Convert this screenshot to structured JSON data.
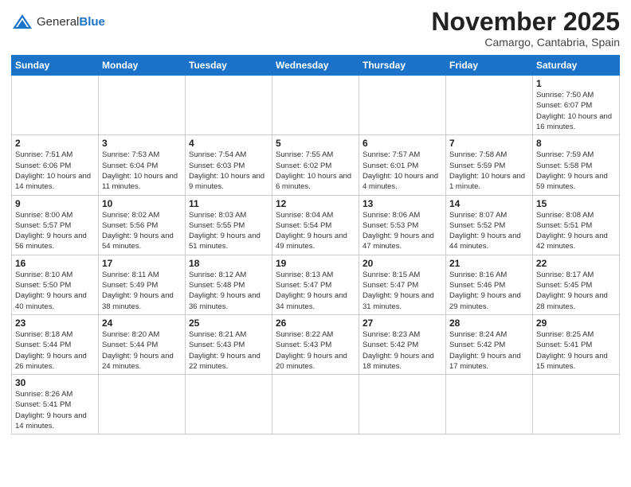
{
  "header": {
    "logo_general": "General",
    "logo_blue": "Blue",
    "month_title": "November 2025",
    "location": "Camargo, Cantabria, Spain"
  },
  "weekdays": [
    "Sunday",
    "Monday",
    "Tuesday",
    "Wednesday",
    "Thursday",
    "Friday",
    "Saturday"
  ],
  "weeks": [
    [
      {
        "day": "",
        "info": ""
      },
      {
        "day": "",
        "info": ""
      },
      {
        "day": "",
        "info": ""
      },
      {
        "day": "",
        "info": ""
      },
      {
        "day": "",
        "info": ""
      },
      {
        "day": "",
        "info": ""
      },
      {
        "day": "1",
        "info": "Sunrise: 7:50 AM\nSunset: 6:07 PM\nDaylight: 10 hours and 16 minutes."
      }
    ],
    [
      {
        "day": "2",
        "info": "Sunrise: 7:51 AM\nSunset: 6:06 PM\nDaylight: 10 hours and 14 minutes."
      },
      {
        "day": "3",
        "info": "Sunrise: 7:53 AM\nSunset: 6:04 PM\nDaylight: 10 hours and 11 minutes."
      },
      {
        "day": "4",
        "info": "Sunrise: 7:54 AM\nSunset: 6:03 PM\nDaylight: 10 hours and 9 minutes."
      },
      {
        "day": "5",
        "info": "Sunrise: 7:55 AM\nSunset: 6:02 PM\nDaylight: 10 hours and 6 minutes."
      },
      {
        "day": "6",
        "info": "Sunrise: 7:57 AM\nSunset: 6:01 PM\nDaylight: 10 hours and 4 minutes."
      },
      {
        "day": "7",
        "info": "Sunrise: 7:58 AM\nSunset: 5:59 PM\nDaylight: 10 hours and 1 minute."
      },
      {
        "day": "8",
        "info": "Sunrise: 7:59 AM\nSunset: 5:58 PM\nDaylight: 9 hours and 59 minutes."
      }
    ],
    [
      {
        "day": "9",
        "info": "Sunrise: 8:00 AM\nSunset: 5:57 PM\nDaylight: 9 hours and 56 minutes."
      },
      {
        "day": "10",
        "info": "Sunrise: 8:02 AM\nSunset: 5:56 PM\nDaylight: 9 hours and 54 minutes."
      },
      {
        "day": "11",
        "info": "Sunrise: 8:03 AM\nSunset: 5:55 PM\nDaylight: 9 hours and 51 minutes."
      },
      {
        "day": "12",
        "info": "Sunrise: 8:04 AM\nSunset: 5:54 PM\nDaylight: 9 hours and 49 minutes."
      },
      {
        "day": "13",
        "info": "Sunrise: 8:06 AM\nSunset: 5:53 PM\nDaylight: 9 hours and 47 minutes."
      },
      {
        "day": "14",
        "info": "Sunrise: 8:07 AM\nSunset: 5:52 PM\nDaylight: 9 hours and 44 minutes."
      },
      {
        "day": "15",
        "info": "Sunrise: 8:08 AM\nSunset: 5:51 PM\nDaylight: 9 hours and 42 minutes."
      }
    ],
    [
      {
        "day": "16",
        "info": "Sunrise: 8:10 AM\nSunset: 5:50 PM\nDaylight: 9 hours and 40 minutes."
      },
      {
        "day": "17",
        "info": "Sunrise: 8:11 AM\nSunset: 5:49 PM\nDaylight: 9 hours and 38 minutes."
      },
      {
        "day": "18",
        "info": "Sunrise: 8:12 AM\nSunset: 5:48 PM\nDaylight: 9 hours and 36 minutes."
      },
      {
        "day": "19",
        "info": "Sunrise: 8:13 AM\nSunset: 5:47 PM\nDaylight: 9 hours and 34 minutes."
      },
      {
        "day": "20",
        "info": "Sunrise: 8:15 AM\nSunset: 5:47 PM\nDaylight: 9 hours and 31 minutes."
      },
      {
        "day": "21",
        "info": "Sunrise: 8:16 AM\nSunset: 5:46 PM\nDaylight: 9 hours and 29 minutes."
      },
      {
        "day": "22",
        "info": "Sunrise: 8:17 AM\nSunset: 5:45 PM\nDaylight: 9 hours and 28 minutes."
      }
    ],
    [
      {
        "day": "23",
        "info": "Sunrise: 8:18 AM\nSunset: 5:44 PM\nDaylight: 9 hours and 26 minutes."
      },
      {
        "day": "24",
        "info": "Sunrise: 8:20 AM\nSunset: 5:44 PM\nDaylight: 9 hours and 24 minutes."
      },
      {
        "day": "25",
        "info": "Sunrise: 8:21 AM\nSunset: 5:43 PM\nDaylight: 9 hours and 22 minutes."
      },
      {
        "day": "26",
        "info": "Sunrise: 8:22 AM\nSunset: 5:43 PM\nDaylight: 9 hours and 20 minutes."
      },
      {
        "day": "27",
        "info": "Sunrise: 8:23 AM\nSunset: 5:42 PM\nDaylight: 9 hours and 18 minutes."
      },
      {
        "day": "28",
        "info": "Sunrise: 8:24 AM\nSunset: 5:42 PM\nDaylight: 9 hours and 17 minutes."
      },
      {
        "day": "29",
        "info": "Sunrise: 8:25 AM\nSunset: 5:41 PM\nDaylight: 9 hours and 15 minutes."
      }
    ],
    [
      {
        "day": "30",
        "info": "Sunrise: 8:26 AM\nSunset: 5:41 PM\nDaylight: 9 hours and 14 minutes."
      },
      {
        "day": "",
        "info": ""
      },
      {
        "day": "",
        "info": ""
      },
      {
        "day": "",
        "info": ""
      },
      {
        "day": "",
        "info": ""
      },
      {
        "day": "",
        "info": ""
      },
      {
        "day": "",
        "info": ""
      }
    ]
  ]
}
